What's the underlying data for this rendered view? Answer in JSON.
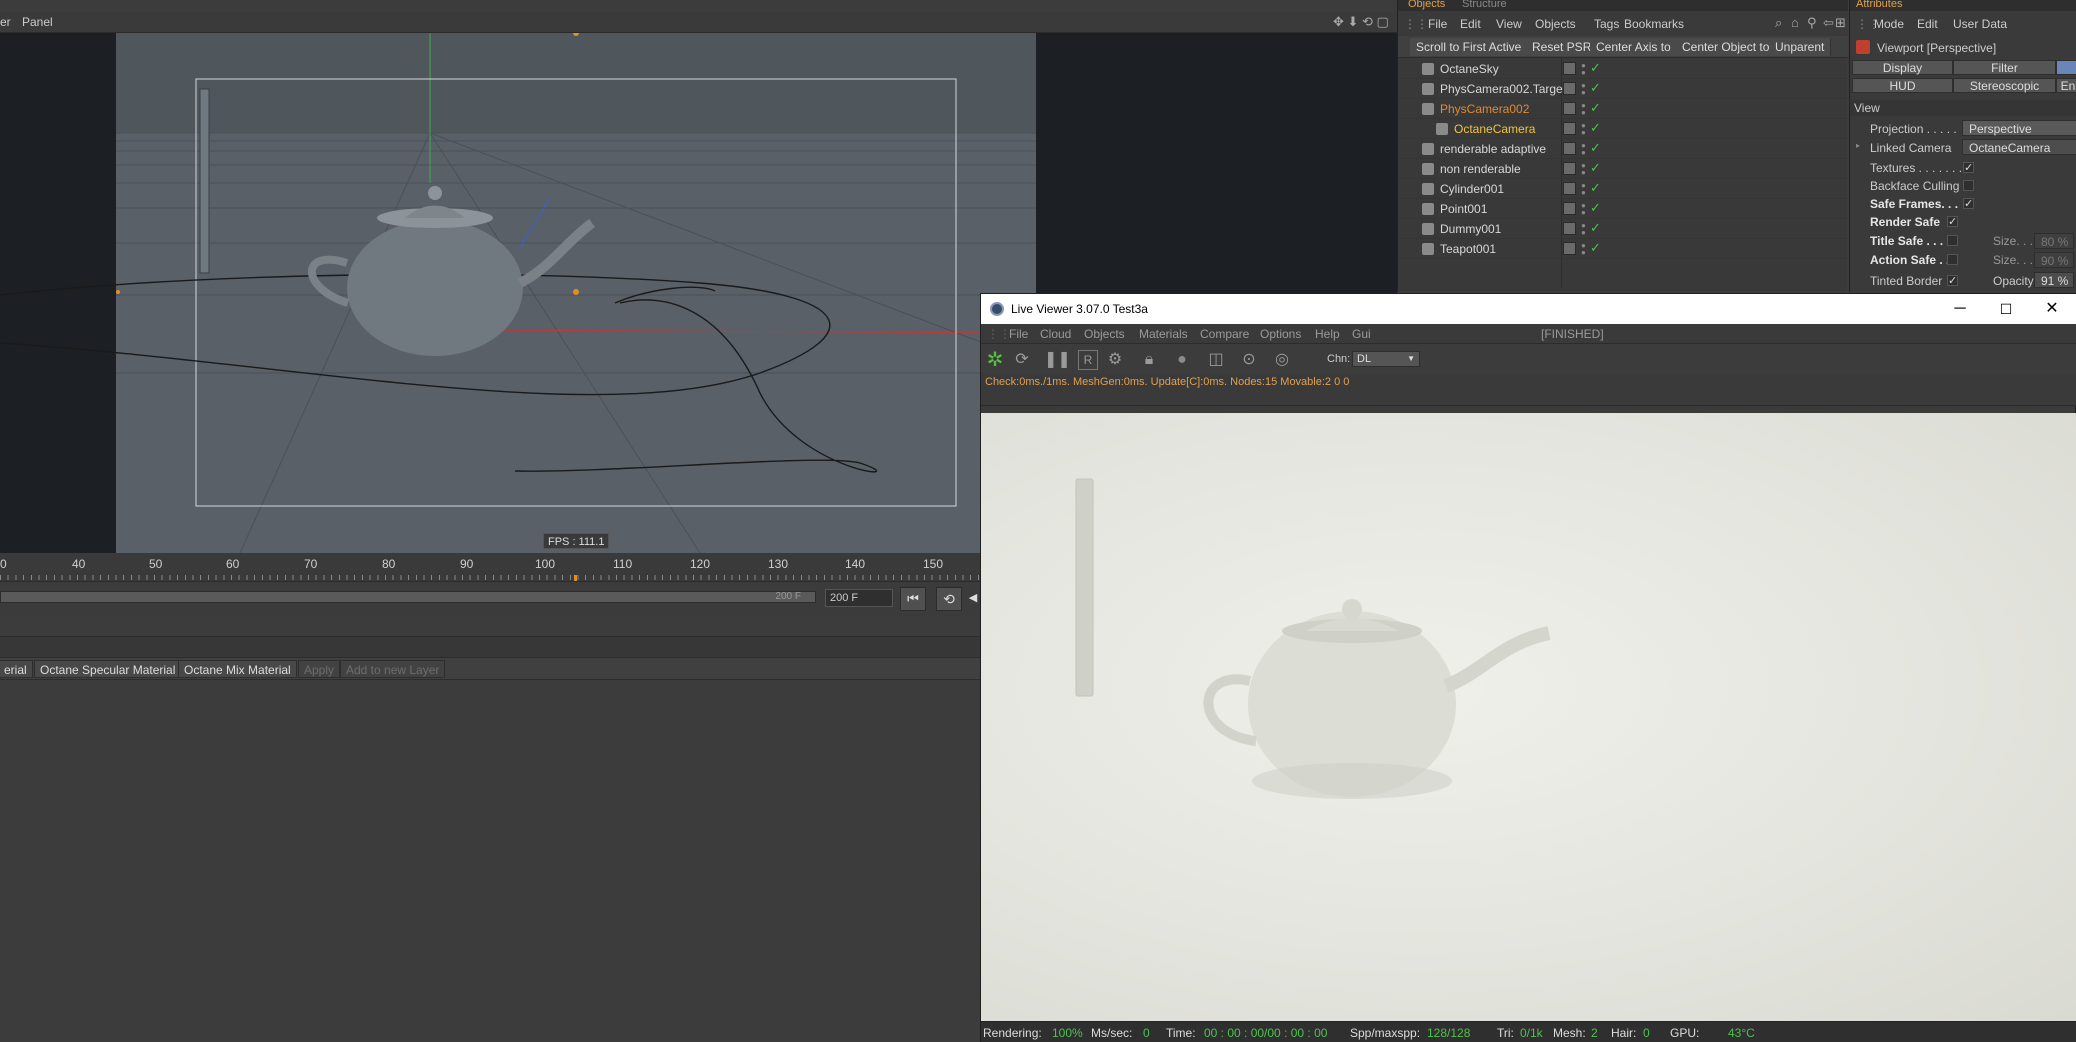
{
  "viewport": {
    "menu": [
      "er",
      "Panel"
    ],
    "fps": "FPS : 111.1"
  },
  "timeline": {
    "ticks": [
      "0",
      "40",
      "50",
      "60",
      "70",
      "80",
      "90",
      "100",
      "110",
      "120",
      "130",
      "140",
      "150"
    ],
    "end_frame_field": "200 F",
    "end_frame_value": "200 F"
  },
  "materials": {
    "tabs": [
      "erial",
      "Octane Specular Material",
      "Octane Mix Material",
      "Apply",
      "Add to new Layer"
    ]
  },
  "objects": {
    "tabs": [
      "Objects",
      "Structure"
    ],
    "menu": [
      "File",
      "Edit",
      "View",
      "Objects",
      "Tags",
      "Bookmarks"
    ],
    "buttons": [
      "Scroll to First Active",
      "Reset PSR",
      "Center Axis to",
      "Center Object to",
      "Unparent"
    ],
    "rows": [
      {
        "name": "OctaneSky",
        "color": "#d8d8d8"
      },
      {
        "name": "PhysCamera002.Target",
        "color": "#d8d8d8"
      },
      {
        "name": "PhysCamera002",
        "color": "#e08a30"
      },
      {
        "name": "OctaneCamera",
        "color": "#f2c43a"
      },
      {
        "name": "renderable adaptive",
        "color": "#d8d8d8"
      },
      {
        "name": "non renderable",
        "color": "#d8d8d8"
      },
      {
        "name": "Cylinder001",
        "color": "#d8d8d8"
      },
      {
        "name": "Point001",
        "color": "#d8d8d8"
      },
      {
        "name": "Dummy001",
        "color": "#d8d8d8"
      },
      {
        "name": "Teapot001",
        "color": "#d8d8d8"
      }
    ]
  },
  "attributes": {
    "tab": "Attributes",
    "menu": [
      "Mode",
      "Edit",
      "User Data"
    ],
    "header": "Viewport [Perspective]",
    "buttons": [
      "Display",
      "Filter",
      "HUD",
      "Stereoscopic",
      "En"
    ],
    "section": "View",
    "projection_label": "Projection . . . . .",
    "projection_value": "Perspective",
    "linked_camera_label": "Linked Camera",
    "linked_camera_value": "OctaneCamera",
    "textures_label": "Textures . . . . . . .",
    "backface_label": "Backface Culling",
    "safe_frames_label": "Safe Frames. . .",
    "render_safe_label": "Render Safe",
    "title_safe_label": "Title Safe . . .",
    "action_safe_label": "Action Safe . .",
    "tinted_border_label": "Tinted Border",
    "size_label": "Size. . .",
    "size1_value": "80 %",
    "size2_value": "90 %",
    "opacity_label": "Opacity",
    "opacity_value": "91 %"
  },
  "liveviewer": {
    "title": "Live Viewer 3.07.0 Test3a",
    "menu": [
      "File",
      "Cloud",
      "Objects",
      "Materials",
      "Compare",
      "Options",
      "Help",
      "Gui"
    ],
    "state": "[FINISHED]",
    "channel_label": "Chn:",
    "channel_value": "DL",
    "info": "Check:0ms./1ms. MeshGen:0ms. Update[C]:0ms. Nodes:15 Movable:2  0 0",
    "status": {
      "rendering_label": "Rendering:",
      "rendering_value": "100%",
      "mssec_label": "Ms/sec:",
      "mssec_value": "0",
      "time_label": "Time:",
      "time_value": "00 : 00 : 00/00 : 00 : 00",
      "spp_label": "Spp/maxspp:",
      "spp_value": "128/128",
      "tri_label": "Tri:",
      "tri_value": "0/1k",
      "mesh_label": "Mesh:",
      "mesh_value": "2",
      "hair_label": "Hair:",
      "hair_value": "0",
      "gpu_label": "GPU:",
      "gpu_value": "43°C"
    }
  }
}
